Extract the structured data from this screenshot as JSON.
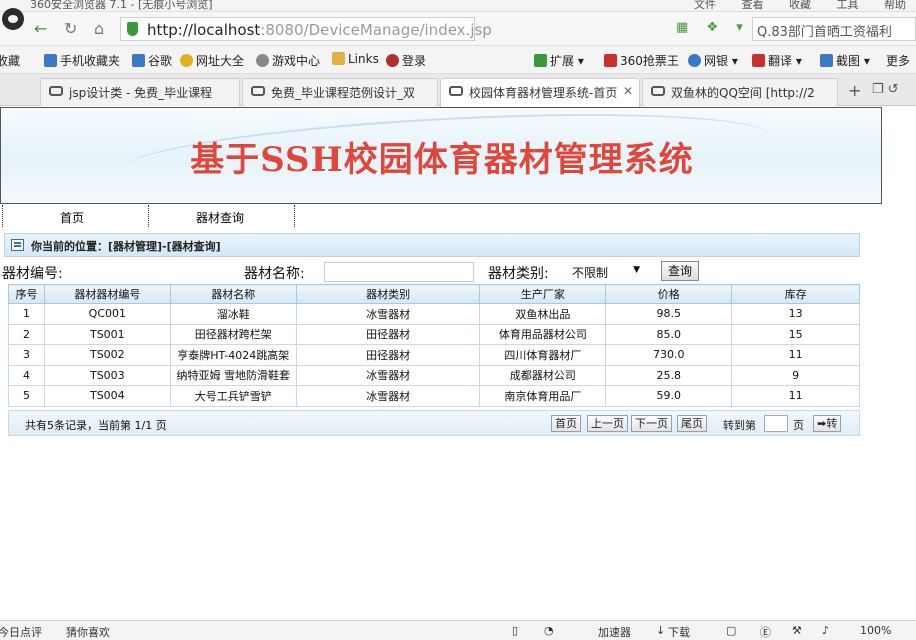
{
  "browser": {
    "title": "360安全浏览器 7.1 - [无痕小号浏览]",
    "title_menu": [
      "文件",
      "查看",
      "收藏",
      "工具",
      "帮助"
    ],
    "url_host": "http://localhost",
    "url_path": ":8080/DeviceManage/index.jsp",
    "search_text": "Q.83部门首晒工资福利",
    "favorites": [
      {
        "label": "收藏",
        "color": "#e0b040"
      },
      {
        "label": "手机收藏夹",
        "color": "#3a78c8"
      },
      {
        "label": "谷歌",
        "color": "#3a78c8"
      },
      {
        "label": "网址大全",
        "color": "#e0b020"
      },
      {
        "label": "游戏中心",
        "color": "#888"
      },
      {
        "label": "Links",
        "color": "#e0b040"
      },
      {
        "label": "登录",
        "color": "#b03030"
      },
      {
        "label": "扩展",
        "color": "#3a9a3a"
      },
      {
        "label": "360抢票王",
        "color": "#c83030"
      },
      {
        "label": "网银",
        "color": "#3a78c8"
      },
      {
        "label": "翻译",
        "color": "#c83030"
      },
      {
        "label": "截图",
        "color": "#3a78c8"
      },
      {
        "label": "更多",
        "color": "#666"
      }
    ],
    "tabs": [
      {
        "label": "jsp设计类 - 免费_毕业课程",
        "active": false
      },
      {
        "label": "免费_毕业课程范例设计_双",
        "active": false
      },
      {
        "label": "校园体育器材管理系统-首页",
        "active": true
      },
      {
        "label": "双鱼林的QQ空间 [http://2",
        "active": false
      }
    ]
  },
  "page": {
    "banner_title": "基于SSH校园体育器材管理系统",
    "menu": [
      "首页",
      "器材查询"
    ],
    "location": "你当前的位置：[器材管理]-[器材查询]",
    "search": {
      "code_label": "器材编号:",
      "name_label": "器材名称:",
      "type_label": "器材类别:",
      "type_value": "不限制",
      "button": "查询"
    },
    "table": {
      "headers": [
        "序号",
        "器材器材编号",
        "器材名称",
        "器材类别",
        "生产厂家",
        "价格",
        "库存"
      ],
      "rows": [
        [
          "1",
          "QC001",
          "溜冰鞋",
          "冰雪器材",
          "双鱼林出品",
          "98.5",
          "13"
        ],
        [
          "2",
          "TS001",
          "田径器材跨栏架",
          "田径器材",
          "体育用品器材公司",
          "85.0",
          "15"
        ],
        [
          "3",
          "TS002",
          "亨泰牌HT-4024跳高架",
          "田径器材",
          "四川体育器材厂",
          "730.0",
          "11"
        ],
        [
          "4",
          "TS003",
          "纳特亚姆 雪地防滑鞋套",
          "冰雪器材",
          "成都器材公司",
          "25.8",
          "9"
        ],
        [
          "5",
          "TS004",
          "大号工兵铲雪铲",
          "冰雪器材",
          "南京体育用品厂",
          "59.0",
          "11"
        ]
      ]
    },
    "pager": {
      "info": "共有5条记录，当前第 1/1 页",
      "first": "首页",
      "prev": "上一页",
      "next": "下一页",
      "last": "尾页",
      "goto_label": "转到第",
      "page_label": "页",
      "go": "➡转"
    }
  },
  "statusbar": {
    "left": "今日点评",
    "guess": "猜你喜欢",
    "accelerator": "加速器",
    "download": "下载",
    "zoom": "100%"
  }
}
